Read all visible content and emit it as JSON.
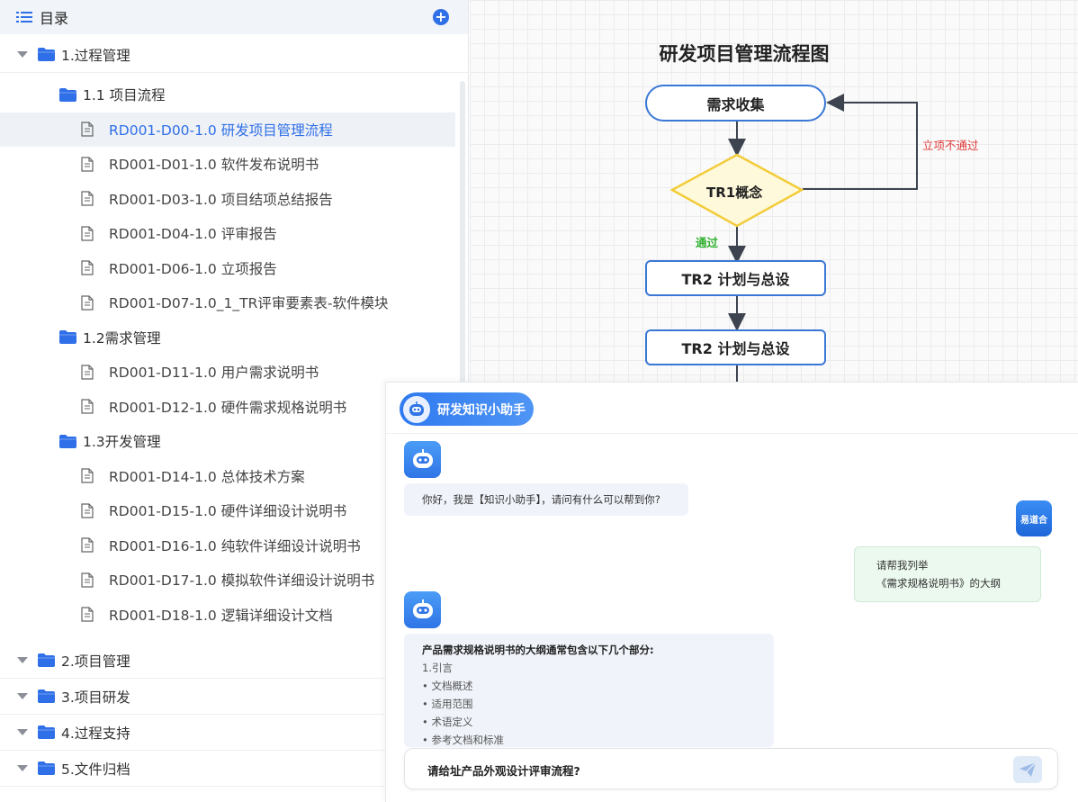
{
  "toc": {
    "title": "目录",
    "add_icon": "plus-circle-icon",
    "sections": [
      {
        "label": "1.过程管理",
        "expanded": true,
        "groups": [
          {
            "label": "1.1 项目流程",
            "docs": [
              "RD001-D00-1.0 研发项目管理流程",
              "RD001-D01-1.0 软件发布说明书",
              "RD001-D03-1.0 项目结项总结报告",
              "RD001-D04-1.0 评审报告",
              "RD001-D06-1.0 立项报告",
              "RD001-D07-1.0_1_TR评审要素表-软件模块"
            ]
          },
          {
            "label": "1.2需求管理",
            "docs": [
              "RD001-D11-1.0 用户需求说明书",
              "RD001-D12-1.0 硬件需求规格说明书"
            ]
          },
          {
            "label": "1.3开发管理",
            "docs": [
              "RD001-D14-1.0 总体技术方案",
              "RD001-D15-1.0 硬件详细设计说明书",
              "RD001-D16-1.0 纯软件详细设计说明书",
              "RD001-D17-1.0 模拟软件详细设计说明书",
              "RD001-D18-1.0 逻辑详细设计文档"
            ]
          }
        ]
      },
      {
        "label": "2.项目管理"
      },
      {
        "label": "3.项目研发"
      },
      {
        "label": "4.过程支持"
      },
      {
        "label": "5.文件归档"
      }
    ],
    "active_doc": "RD001-D00-1.0 研发项目管理流程"
  },
  "flowchart": {
    "title": "研发项目管理流程图",
    "nodes": {
      "collect": "需求收集",
      "tr1": "TR1概念",
      "tr2a": "TR2 计划与总设",
      "tr2b": "TR2 计划与总设"
    },
    "edge_labels": {
      "reject": "立项不通过",
      "pass": "通过"
    },
    "colors": {
      "node_border": "#3b78d6",
      "diamond_fill": "#fff9db",
      "diamond_border": "#f2cc3a",
      "reject": "#e03b3b",
      "pass": "#2fb12f"
    }
  },
  "chat": {
    "bot_name": "研发知识小助手",
    "messages": [
      {
        "role": "bot",
        "lines": [
          "你好，我是【知识小助手】，请问有什么可以帮到你?"
        ]
      },
      {
        "role": "user",
        "avatar_text": "易道合",
        "lines": [
          "请帮我列举",
          "《需求规格说明书》的大纲"
        ]
      },
      {
        "role": "bot",
        "lines": [
          "产品需求规格说明书的大纲通常包含以下几个部分:",
          "1.引言",
          "• 文档概述",
          "• 适用范围",
          "• 术语定义",
          "• 参考文档和标准"
        ]
      }
    ],
    "input": {
      "value": "请给址产品外观设计评审流程?"
    },
    "send_icon": "paper-plane-icon"
  }
}
